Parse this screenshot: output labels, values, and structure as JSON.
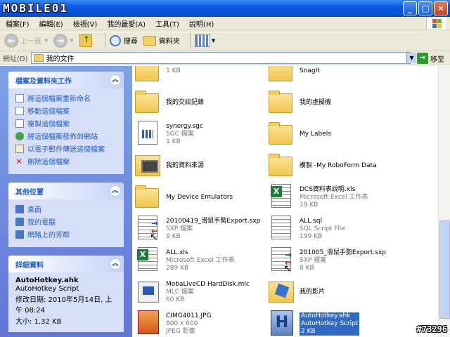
{
  "window": {
    "logo_text": "MOBILE01",
    "buttons": [
      "_",
      "□",
      "✕"
    ]
  },
  "menu": [
    "檔案(F)",
    "編輯(E)",
    "檢視(V)",
    "我的最愛(A)",
    "工具(T)",
    "說明(H)"
  ],
  "toolbar": {
    "back": "上一頁",
    "search": "搜尋",
    "folders": "資料夾"
  },
  "address": {
    "label": "網址(D)",
    "value": "我的文件",
    "go": "移至"
  },
  "tasks": {
    "title": "檔案及資料夾工作",
    "items": [
      {
        "label": "將這個檔案重新命名",
        "icon": "rename-icon"
      },
      {
        "label": "移動這個檔案",
        "icon": "move-icon"
      },
      {
        "label": "複製這個檔案",
        "icon": "copy-icon"
      },
      {
        "label": "將這個檔案發佈到網站",
        "icon": "publish-icon"
      },
      {
        "label": "以電子郵件傳送這個檔案",
        "icon": "email-icon"
      },
      {
        "label": "刪除這個檔案",
        "icon": "delete-icon"
      }
    ]
  },
  "places": {
    "title": "其他位置",
    "items": [
      {
        "label": "桌面",
        "icon": "desktop-icon"
      },
      {
        "label": "我的電腦",
        "icon": "computer-icon"
      },
      {
        "label": "網路上的芳鄰",
        "icon": "network-icon"
      }
    ]
  },
  "details": {
    "title": "詳細資料",
    "name": "AutoHotkey.ahk",
    "type": "AutoHotkey Script",
    "modified": "修改日期: 2010年5月14日, 上午 08:24",
    "size": "大小: 1.32 KB"
  },
  "files": [
    {
      "name": "",
      "line2": "",
      "line3": "1 KB",
      "icon": "folder-partial-icon",
      "col": 0,
      "row": -1
    },
    {
      "name": "SnagIt",
      "line2": "",
      "line3": "",
      "icon": "folder-icon",
      "col": 1,
      "row": -1
    },
    {
      "name": "我的交談記錄",
      "line2": "",
      "line3": "",
      "icon": "folder-icon",
      "col": 0,
      "row": 0
    },
    {
      "name": "我的虛擬機",
      "line2": "",
      "line3": "",
      "icon": "folder-icon",
      "col": 1,
      "row": 0
    },
    {
      "name": "synergy.sgc",
      "line2": "SGC 檔案",
      "line3": "1 KB",
      "icon": "sgc-file-icon",
      "col": 0,
      "row": 1
    },
    {
      "name": "My Labels",
      "line2": "",
      "line3": "",
      "icon": "folder-icon",
      "col": 1,
      "row": 1
    },
    {
      "name": "我的資料來源",
      "line2": "",
      "line3": "",
      "icon": "data-source-icon",
      "col": 0,
      "row": 2
    },
    {
      "name": "複製 -My RoboForm Data",
      "line2": "",
      "line3": "",
      "icon": "folder-icon",
      "col": 1,
      "row": 2
    },
    {
      "name": "My Device Emulators",
      "line2": "",
      "line3": "",
      "icon": "folder-icon",
      "col": 0,
      "row": 3
    },
    {
      "name": "DCS資料表說明.xls",
      "line2": "Microsoft Excel 工作表",
      "line3": "19 KB",
      "icon": "excel-file-icon",
      "col": 1,
      "row": 3
    },
    {
      "name": "20100419_滑鼠手勢Export.sxp",
      "line2": "SXP 檔案",
      "line3": "9 KB",
      "icon": "sxp-file-icon",
      "col": 0,
      "row": 4
    },
    {
      "name": "ALL.sql",
      "line2": "SQL Script File",
      "line3": "199 KB",
      "icon": "sql-file-icon",
      "col": 1,
      "row": 4
    },
    {
      "name": "ALL.xls",
      "line2": "Microsoft Excel 工作表",
      "line3": "289 KB",
      "icon": "excel-file-icon",
      "col": 0,
      "row": 5
    },
    {
      "name": "201005_滑鼠手勢Export.sxp",
      "line2": "SXP 檔案",
      "line3": "8 KB",
      "icon": "sxp-file-icon",
      "col": 1,
      "row": 5
    },
    {
      "name": "MobaLiveCD HardDisk.mlc",
      "line2": "MLC 檔案",
      "line3": "60 KB",
      "icon": "mlc-file-icon",
      "col": 0,
      "row": 6
    },
    {
      "name": "我的影片",
      "line2": "",
      "line3": "",
      "icon": "video-folder-icon",
      "col": 1,
      "row": 6
    },
    {
      "name": "CIMG4011.JPG",
      "line2": "800 x 600",
      "line3": "JPEG 影像",
      "icon": "jpeg-file-icon",
      "col": 0,
      "row": 7
    },
    {
      "name": "AutoHotkey.ahk",
      "line2": "AutoHotkey Script",
      "line3": "2 KB",
      "icon": "ahk-file-icon",
      "col": 1,
      "row": 7,
      "selected": true
    }
  ],
  "watermark": "#73296"
}
